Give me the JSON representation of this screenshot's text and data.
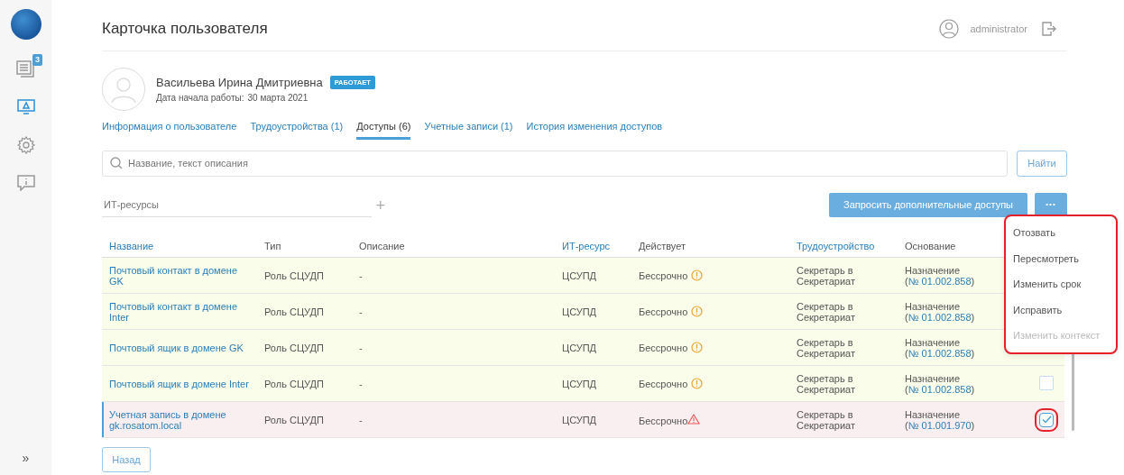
{
  "sidebar": {
    "items": [
      {
        "kind": "documents",
        "badge": "3",
        "selected": false
      },
      {
        "kind": "monitor",
        "selected": true
      },
      {
        "kind": "gear",
        "selected": false
      },
      {
        "kind": "comment",
        "selected": false
      }
    ],
    "expand": "»"
  },
  "header": {
    "title": "Карточка пользователя",
    "user": "administrator"
  },
  "profile": {
    "name": "Васильева Ирина Дмитриевна",
    "status": "РАБОТАЕТ",
    "start_label": "Дата начала работы:",
    "start_date": "30 марта 2021"
  },
  "tabs": [
    {
      "label": "Информация о пользователе",
      "selected": false
    },
    {
      "label": "Трудоустройства (1)",
      "selected": false
    },
    {
      "label": "Доступы (6)",
      "selected": true
    },
    {
      "label": "Учетные записи (1)",
      "selected": false
    },
    {
      "label": "История изменения доступов",
      "selected": false
    }
  ],
  "search": {
    "placeholder": "Название, текст описания",
    "button": "Найти"
  },
  "filter": {
    "placeholder": "ИТ-ресурсы",
    "add": "+"
  },
  "actions": {
    "request": "Запросить дополнительные доступы",
    "more": "•••"
  },
  "menu": {
    "highlighted": true,
    "items": [
      {
        "label": "Отозвать",
        "disabled": false
      },
      {
        "label": "Пересмотреть",
        "disabled": false
      },
      {
        "label": "Изменить срок",
        "disabled": false
      },
      {
        "label": "Исправить",
        "disabled": false
      },
      {
        "label": "Изменить контекст",
        "disabled": true
      }
    ]
  },
  "table": {
    "columns": [
      {
        "label": "Название",
        "sortable": true
      },
      {
        "label": "Тип",
        "sortable": false
      },
      {
        "label": "Описание",
        "sortable": false
      },
      {
        "label": "ИТ-ресурс",
        "sortable": true
      },
      {
        "label": "Действует",
        "sortable": false
      },
      {
        "label": "Трудоустройство",
        "sortable": true
      },
      {
        "label": "Основание",
        "sortable": false
      }
    ],
    "rows": [
      {
        "name": "Почтовый контакт в домене GK",
        "type": "Роль СЦУДП",
        "description": "-",
        "resource": "ЦСУПД",
        "valid": "Бессрочно",
        "kind": "warning",
        "job": "Секретарь в Секретариат",
        "basis": "Назначение (",
        "basis_link": "№ 01.002.858",
        "basis_end": ")",
        "selected": false
      },
      {
        "name": "Почтовый контакт в домене Inter",
        "type": "Роль СЦУДП",
        "description": "-",
        "resource": "ЦСУПД",
        "valid": "Бессрочно",
        "kind": "warning",
        "job": "Секретарь в Секретариат",
        "basis": "Назначение (",
        "basis_link": "№ 01.002.858",
        "basis_end": ")",
        "selected": false
      },
      {
        "name": "Почтовый ящик в домене GK",
        "type": "Роль СЦУДП",
        "description": "-",
        "resource": "ЦСУПД",
        "valid": "Бессрочно",
        "kind": "warning",
        "job": "Секретарь в Секретариат",
        "basis": "Назначение (",
        "basis_link": "№ 01.002.858",
        "basis_end": ")",
        "selected": false
      },
      {
        "name": "Почтовый ящик в домене Inter",
        "type": "Роль СЦУДП",
        "description": "-",
        "resource": "ЦСУПД",
        "valid": "Бессрочно",
        "kind": "warning",
        "job": "Секретарь в Секретариат",
        "basis": "Назначение (",
        "basis_link": "№ 01.002.858",
        "basis_end": ")",
        "checked": false,
        "selected": false,
        "highlighted": false
      },
      {
        "name": "Учетная запись в домене gk.rosatom.local",
        "type": "Роль СЦУДП",
        "description": "-",
        "resource": "ЦСУПД",
        "valid": "Бессрочно",
        "kind": "error",
        "job": "Секретарь в Секретариат",
        "basis": "Назначение (",
        "basis_link": "№ 01.001.970",
        "basis_end": ")",
        "checked": true,
        "selected": true,
        "highlighted": true
      }
    ]
  },
  "back": "Назад"
}
